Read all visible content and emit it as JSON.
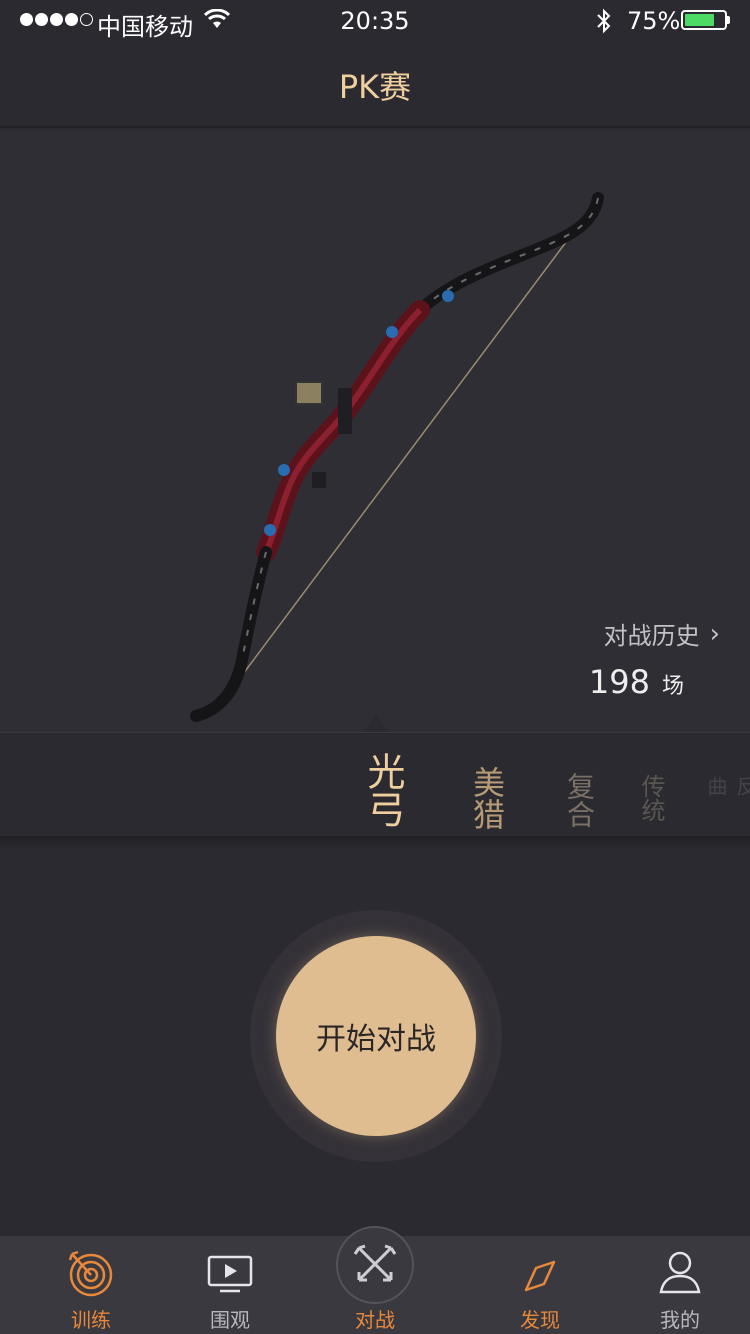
{
  "status_bar": {
    "carrier": "中国移动",
    "time": "20:35",
    "battery_percent": "75%",
    "battery_level": 0.75,
    "signal_bars": 4
  },
  "nav": {
    "title": "PK赛"
  },
  "hero": {
    "image": "bow-image",
    "history_label": "对战历史",
    "history_count": "198",
    "history_unit": "场"
  },
  "categories": [
    {
      "label": "光弓",
      "selected": true
    },
    {
      "label": "美猎"
    },
    {
      "label": "复合"
    },
    {
      "label": "传统"
    },
    {
      "label": "反曲"
    }
  ],
  "start_button": {
    "label": "开始对战"
  },
  "tab_bar": {
    "items": [
      {
        "label": "训练",
        "icon": "target-icon",
        "color": "#e8883a"
      },
      {
        "label": "围观",
        "icon": "video-play-icon",
        "color": "#b9b7bd"
      },
      {
        "label": "对战",
        "icon": "crossed-arrows-icon",
        "color": "#e8883a"
      },
      {
        "label": "发现",
        "icon": "compass-icon",
        "color": "#e8883a"
      },
      {
        "label": "我的",
        "icon": "user-icon",
        "color": "#b9b7bd"
      }
    ]
  },
  "colors": {
    "accent": "#f0cf9e",
    "tab_active": "#e8883a",
    "background": "#2b2a30",
    "button": "#e0bd90"
  }
}
